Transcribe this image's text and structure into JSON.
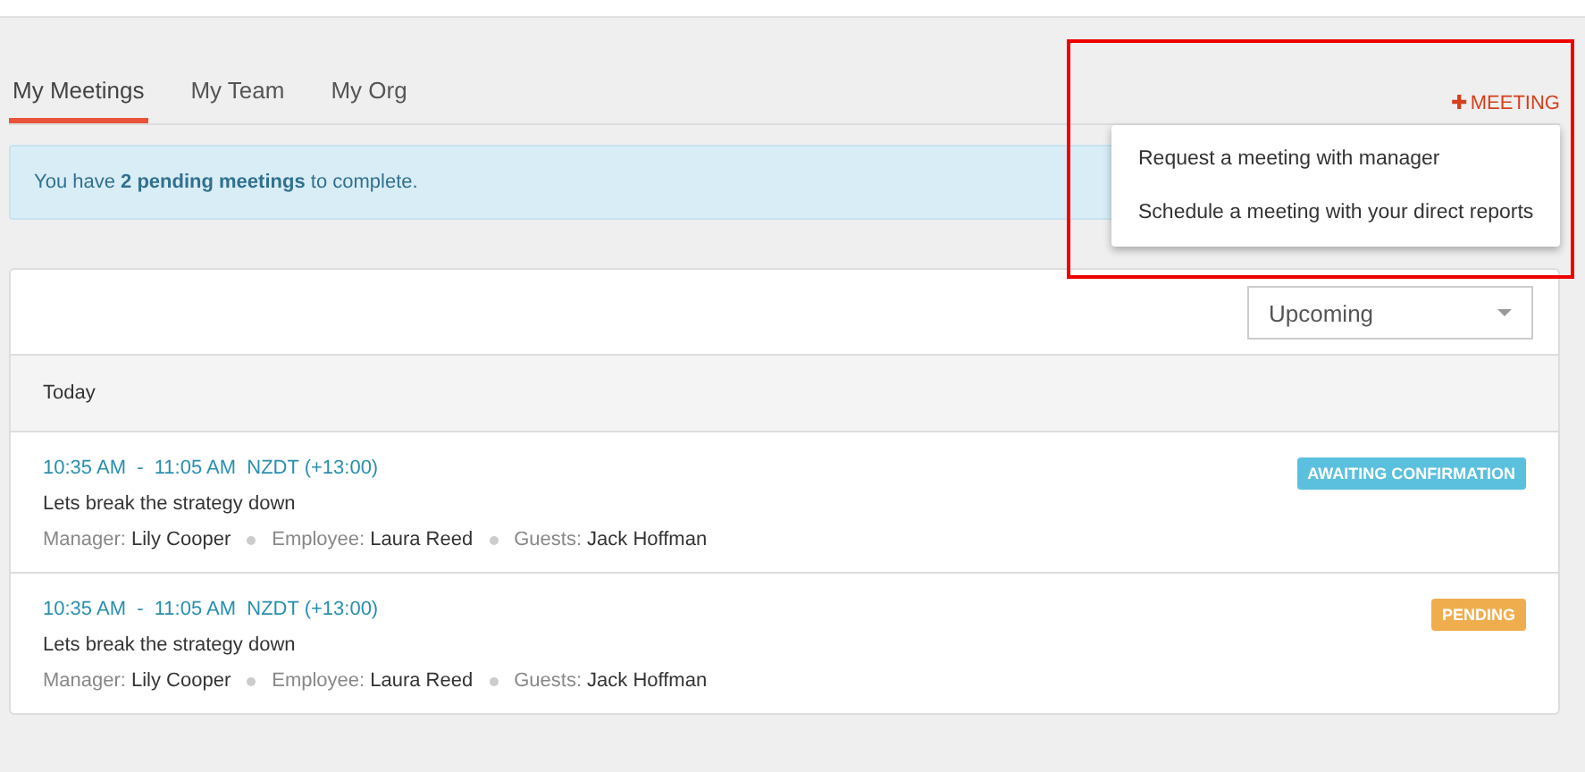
{
  "tabs": [
    {
      "label": "My Meetings",
      "selected": true
    },
    {
      "label": "My Team",
      "selected": false
    },
    {
      "label": "My Org",
      "selected": false
    }
  ],
  "add_button": {
    "icon": "✚",
    "label": "MEETING"
  },
  "menu": {
    "items": [
      "Request a meeting with manager",
      "Schedule a meeting with your direct reports"
    ]
  },
  "alert": "You have **2 pending meetings** to complete.",
  "filter": {
    "value": "Upcoming"
  },
  "group": "Today",
  "meetings": [
    {
      "time": "10:35 AM  -  11:05 AM  NZDT (+13:00)",
      "title": "Lets break the strategy down",
      "meta": [
        {
          "label": "Manager:",
          "value": "Lily Cooper"
        },
        {
          "label": "Employee:",
          "value": "Laura Reed"
        },
        {
          "label": "Guests:",
          "value": "Jack Hoffman"
        }
      ],
      "status": {
        "label": "AWAITING CONFIRMATION",
        "color": "#5bc0de"
      }
    },
    {
      "time": "10:35 AM  -  11:05 AM  NZDT (+13:00)",
      "title": "Lets break the strategy down",
      "meta": [
        {
          "label": "Manager:",
          "value": "Lily Cooper"
        },
        {
          "label": "Employee:",
          "value": "Laura Reed"
        },
        {
          "label": "Guests:",
          "value": "Jack Hoffman"
        }
      ],
      "status": {
        "label": "PENDING",
        "color": "#f0ad4e"
      }
    }
  ]
}
